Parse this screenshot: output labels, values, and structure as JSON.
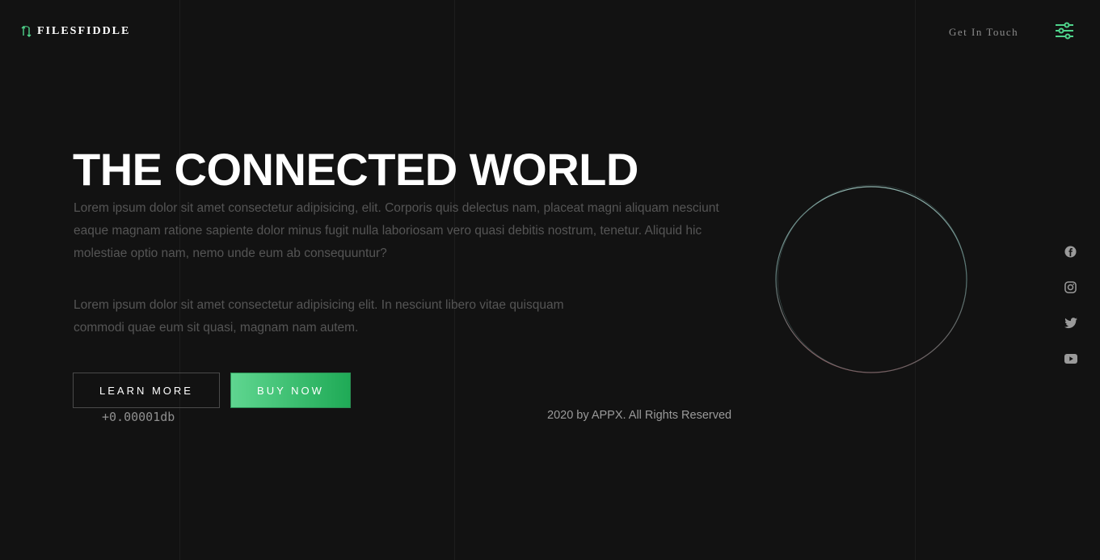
{
  "header": {
    "logo_text": "FILESFIDDLE",
    "get_in_touch": "Get In Touch"
  },
  "hero": {
    "title": "THE CONNECTED WORLD",
    "paragraph_1": "Lorem ipsum dolor sit amet consectetur adipisicing, elit. Corporis quis delectus nam, placeat magni aliquam nesciunt eaque magnam ratione sapiente dolor minus fugit nulla laboriosam vero quasi debitis nostrum, tenetur. Aliquid hic molestiae optio nam, nemo unde eum ab consequuntur?",
    "paragraph_2": "Lorem ipsum dolor sit amet consectetur adipisicing elit. In nesciunt libero vitae quisquam commodi quae eum sit quasi, magnam nam autem.",
    "learn_more_label": "LEARN MORE",
    "buy_now_label": "BUY NOW",
    "readout": "+0.00001db"
  },
  "footer": {
    "copyright": "2020 by APPX. All Rights Reserved"
  },
  "social": [
    "facebook-icon",
    "instagram-icon",
    "twitter-icon",
    "youtube-icon"
  ],
  "colors": {
    "background": "#121212",
    "accent_green": "#4fd38b",
    "button_gradient_start": "#5fd690",
    "button_gradient_end": "#1faa56",
    "muted_text": "#555555"
  }
}
